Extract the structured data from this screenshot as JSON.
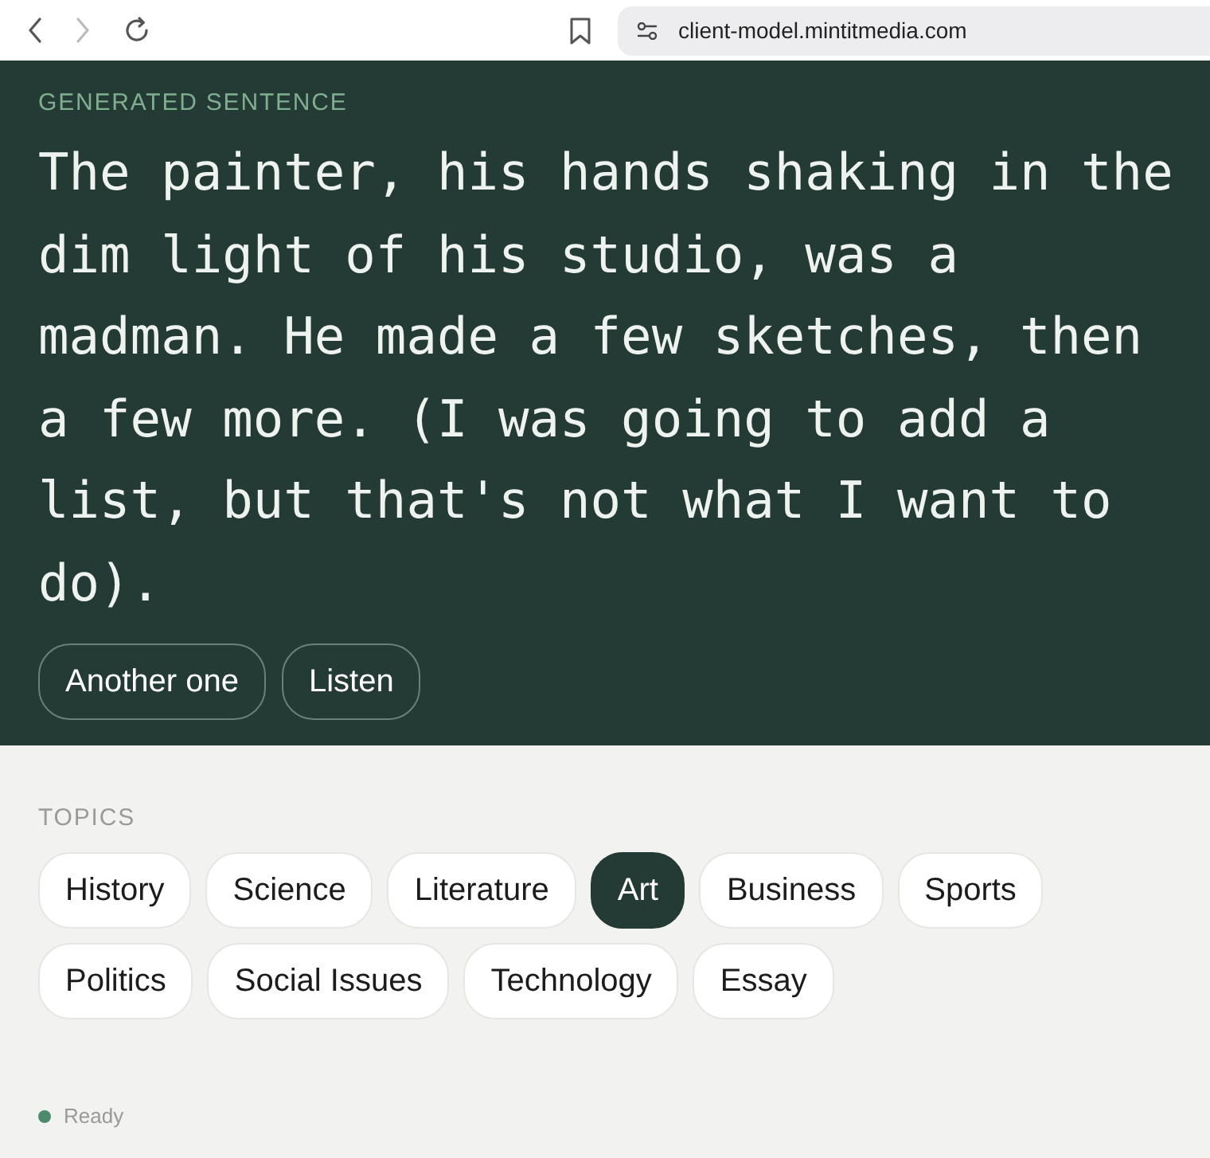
{
  "browser": {
    "url": "client-model.mintitmedia.com",
    "forward_enabled": false
  },
  "generated": {
    "label": "GENERATED SENTENCE",
    "sentence": "The painter, his hands shaking in the dim light of his studio, was a madman. He made a few sketches, then a few more. (I was going to add a list, but that's not what I want to do).",
    "actions": [
      "Another one",
      "Listen"
    ]
  },
  "topics": {
    "label": "TOPICS",
    "items": [
      {
        "label": "History",
        "selected": false
      },
      {
        "label": "Science",
        "selected": false
      },
      {
        "label": "Literature",
        "selected": false
      },
      {
        "label": "Art",
        "selected": true
      },
      {
        "label": "Business",
        "selected": false
      },
      {
        "label": "Sports",
        "selected": false
      },
      {
        "label": "Politics",
        "selected": false
      },
      {
        "label": "Social Issues",
        "selected": false
      },
      {
        "label": "Technology",
        "selected": false
      },
      {
        "label": "Essay",
        "selected": false
      }
    ]
  },
  "status_bar": {
    "text": "Ready"
  }
}
